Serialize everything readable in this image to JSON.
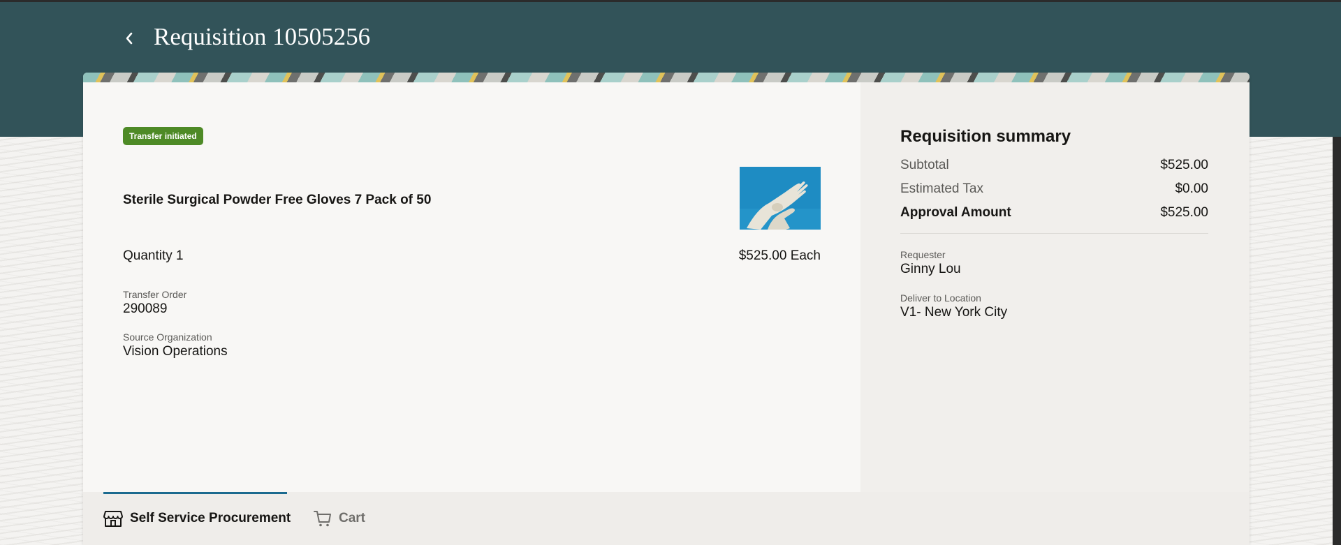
{
  "header": {
    "title": "Requisition 10505256"
  },
  "line_item": {
    "status_badge": "Transfer initiated",
    "name": "Sterile Surgical Powder Free Gloves 7 Pack of 50",
    "quantity": "Quantity 1",
    "unit_price": "$525.00 Each",
    "fields": [
      {
        "label": "Transfer Order",
        "value": "290089"
      },
      {
        "label": "Source Organization",
        "value": "Vision Operations"
      }
    ]
  },
  "summary": {
    "title": "Requisition summary",
    "rows": [
      {
        "label": "Subtotal",
        "value": "$525.00"
      },
      {
        "label": "Estimated Tax",
        "value": "$0.00"
      },
      {
        "label": "Approval Amount",
        "value": "$525.00"
      }
    ],
    "requester_label": "Requester",
    "requester_value": "Ginny Lou",
    "location_label": "Deliver to Location",
    "location_value": "V1- New York City"
  },
  "bottom_nav": {
    "tabs": [
      {
        "label": "Self Service Procurement",
        "icon": "store-icon",
        "active": true
      },
      {
        "label": "Cart",
        "icon": "cart-icon",
        "active": false
      }
    ]
  },
  "colors": {
    "header_band": "#325359",
    "status_badge": "#4e8a26",
    "tab_indicator": "#1b6a8f"
  }
}
